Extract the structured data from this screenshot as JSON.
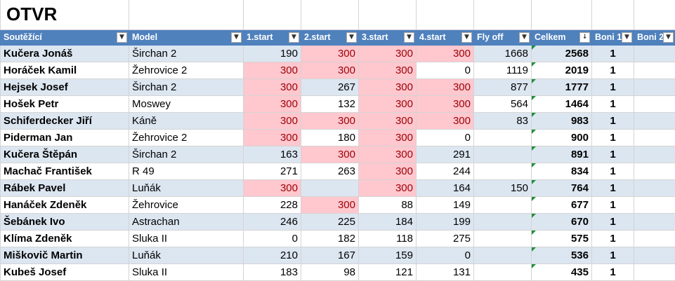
{
  "sheet_title": "OTVR",
  "headers": [
    "Soutěžící",
    "Model",
    "1.start",
    "2.start",
    "3.start",
    "4.start",
    "Fly off",
    "Celkem",
    "Boni 1",
    "Boni 2"
  ],
  "colors": {
    "header_bg": "#4f81bd",
    "band_bg": "#dce6f1",
    "highlight_bg": "#ffc7ce",
    "highlight_text": "#9c0006"
  },
  "rows": [
    {
      "name": "Kučera Jonáš",
      "model": "Širchan 2",
      "s1": "190",
      "s2": "300",
      "s3": "300",
      "s4": "300",
      "fly": "1668",
      "total": "2568",
      "b1": "1",
      "b2": ""
    },
    {
      "name": "Horáček Kamil",
      "model": "Žehrovice 2",
      "s1": "300",
      "s2": "300",
      "s3": "300",
      "s4": "0",
      "fly": "1119",
      "total": "2019",
      "b1": "1",
      "b2": ""
    },
    {
      "name": "Hejsek Josef",
      "model": "Širchan 2",
      "s1": "300",
      "s2": "267",
      "s3": "300",
      "s4": "300",
      "fly": "877",
      "total": "1777",
      "b1": "1",
      "b2": ""
    },
    {
      "name": "Hošek Petr",
      "model": "Moswey",
      "s1": "300",
      "s2": "132",
      "s3": "300",
      "s4": "300",
      "fly": "564",
      "total": "1464",
      "b1": "1",
      "b2": ""
    },
    {
      "name": "Schiferdecker Jiří",
      "model": "Káně",
      "s1": "300",
      "s2": "300",
      "s3": "300",
      "s4": "300",
      "fly": "83",
      "total": "983",
      "b1": "1",
      "b2": ""
    },
    {
      "name": "Piderman Jan",
      "model": "Žehrovice 2",
      "s1": "300",
      "s2": "180",
      "s3": "300",
      "s4": "0",
      "fly": "",
      "total": "900",
      "b1": "1",
      "b2": ""
    },
    {
      "name": "Kučera Štěpán",
      "model": "Širchan 2",
      "s1": "163",
      "s2": "300",
      "s3": "300",
      "s4": "291",
      "fly": "",
      "total": "891",
      "b1": "1",
      "b2": ""
    },
    {
      "name": "Machač František",
      "model": "R 49",
      "s1": "271",
      "s2": "263",
      "s3": "300",
      "s4": "244",
      "fly": "",
      "total": "834",
      "b1": "1",
      "b2": ""
    },
    {
      "name": "Rábek Pavel",
      "model": "Luňák",
      "s1": "300",
      "s2": "",
      "s3": "300",
      "s4": "164",
      "fly": "150",
      "total": "764",
      "b1": "1",
      "b2": ""
    },
    {
      "name": "Hanáček Zdeněk",
      "model": "Žehrovice",
      "s1": "228",
      "s2": "300",
      "s3": "88",
      "s4": "149",
      "fly": "",
      "total": "677",
      "b1": "1",
      "b2": ""
    },
    {
      "name": "Šebánek Ivo",
      "model": "Astrachan",
      "s1": "246",
      "s2": "225",
      "s3": "184",
      "s4": "199",
      "fly": "",
      "total": "670",
      "b1": "1",
      "b2": ""
    },
    {
      "name": "Klíma Zdeněk",
      "model": "Sluka II",
      "s1": "0",
      "s2": "182",
      "s3": "118",
      "s4": "275",
      "fly": "",
      "total": "575",
      "b1": "1",
      "b2": ""
    },
    {
      "name": "Miškovič Martin",
      "model": "Luňák",
      "s1": "210",
      "s2": "167",
      "s3": "159",
      "s4": "0",
      "fly": "",
      "total": "536",
      "b1": "1",
      "b2": ""
    },
    {
      "name": "Kubeš Josef",
      "model": "Sluka II",
      "s1": "183",
      "s2": "98",
      "s3": "121",
      "s4": "131",
      "fly": "",
      "total": "435",
      "b1": "1",
      "b2": ""
    }
  ]
}
